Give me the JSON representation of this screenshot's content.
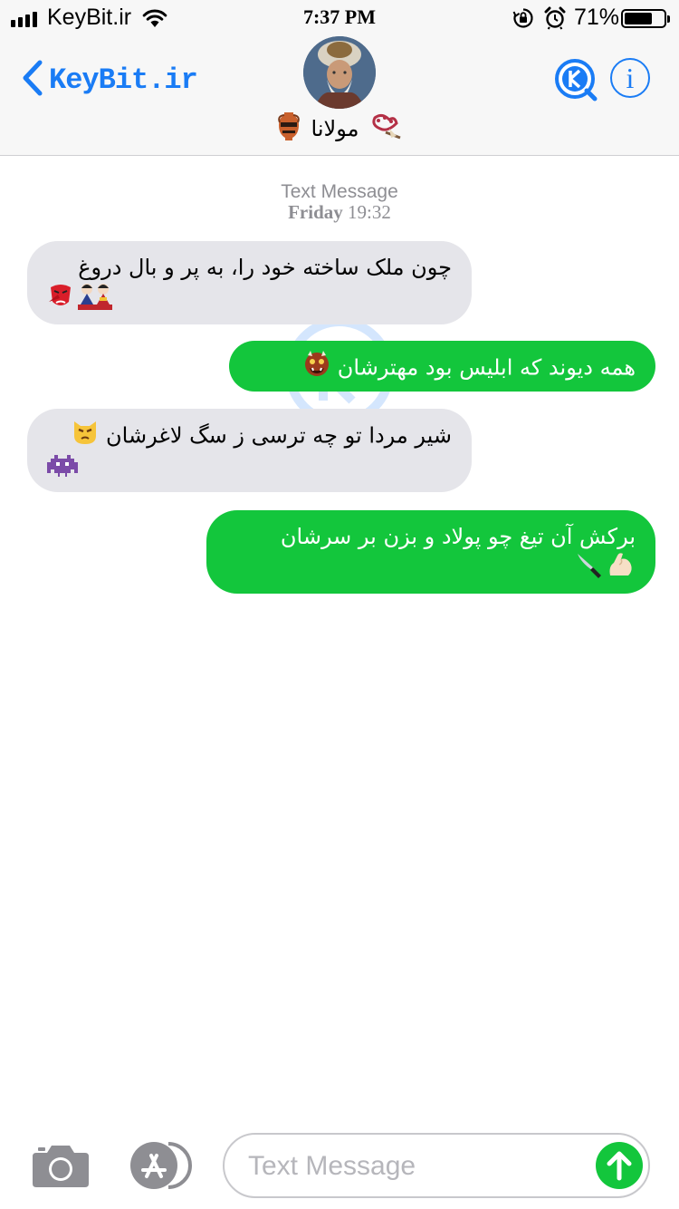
{
  "status_bar": {
    "carrier": "KeyBit.ir",
    "time": "7:37 PM",
    "battery_percent": "71%",
    "battery_level": 0.71,
    "signal_bars": 4,
    "icons": [
      "signal-icon",
      "wifi-icon",
      "rotation-lock-icon",
      "alarm-icon",
      "battery-icon"
    ]
  },
  "header": {
    "back_label": "KeyBit.ir",
    "contact_name": "مولانا",
    "contact_emoji_left": "amphora-emoji",
    "contact_emoji_right": "bouquet-emoji",
    "avatar": "contact-avatar",
    "icons": [
      "chevron-left-icon",
      "keybit-logo-icon",
      "info-icon"
    ]
  },
  "conversation": {
    "service": "Text Message",
    "day": "Friday",
    "time": "19:32",
    "messages": [
      {
        "direction": "incoming",
        "text": "چون ملک ساخته خود را، به پر و بال دروغ",
        "emojis": [
          "tengu-mask-emoji",
          "dolls-emoji"
        ]
      },
      {
        "direction": "outgoing",
        "text": "همه دیوند که ابلیس بود مهترشان",
        "emojis": [
          "ogre-mask-emoji"
        ]
      },
      {
        "direction": "incoming",
        "text": "شیر مردا تو چه ترسی ز سگ لاغرشان",
        "emojis": [
          "pouting-cat-emoji",
          "alien-monster-emoji"
        ]
      },
      {
        "direction": "outgoing",
        "text": "برکش آن تیغ چو پولاد و بزن بر سرشان",
        "emojis": [
          "flexed-biceps-emoji",
          "knife-emoji"
        ]
      }
    ]
  },
  "input_bar": {
    "placeholder": "Text Message",
    "value": "",
    "icons": [
      "camera-icon",
      "app-store-icon",
      "send-arrow-icon"
    ]
  },
  "colors": {
    "accent_blue": "#1a7cf5",
    "sms_green": "#13c63c",
    "incoming_gray": "#e5e5ea",
    "header_bg": "#f7f7f7"
  }
}
